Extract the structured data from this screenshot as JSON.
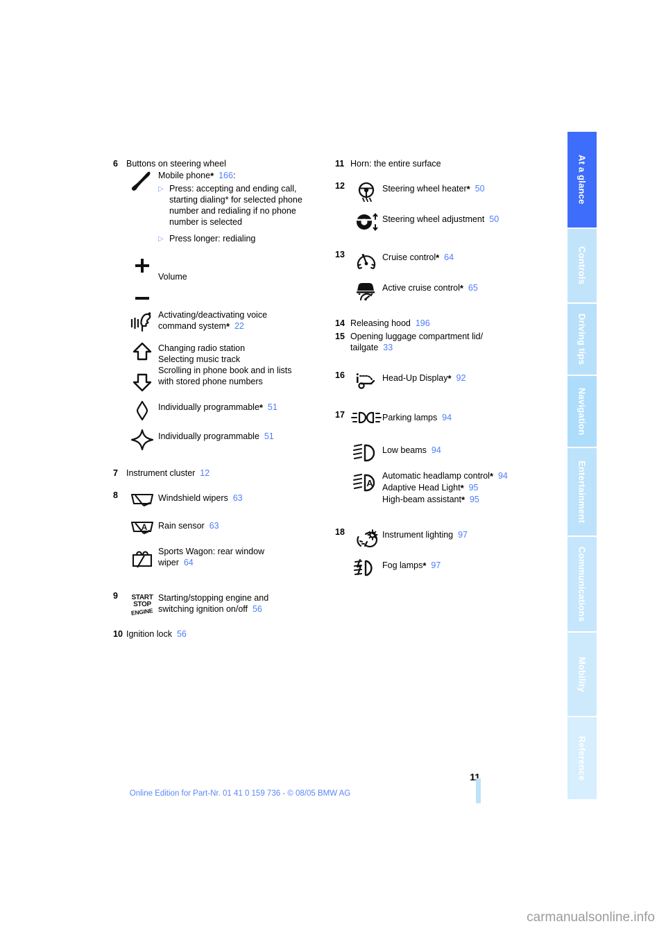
{
  "document": {
    "page_number": "11",
    "edition_line": "Online Edition for Part-Nr. 01 41 0 159 736 - © 08/05 BMW AG",
    "watermark": "carmanualsonline.info",
    "accent_page_ref_color": "#4d7dfb",
    "active_tab_color": "#3d6dfa"
  },
  "sidebar": {
    "tabs": [
      {
        "label": "At a glance",
        "active": true
      },
      {
        "label": "Controls",
        "active": false
      },
      {
        "label": "Driving tips",
        "active": false
      },
      {
        "label": "Navigation",
        "active": false
      },
      {
        "label": "Entertainment",
        "active": false
      },
      {
        "label": "Communications",
        "active": false
      },
      {
        "label": "Mobility",
        "active": false
      },
      {
        "label": "Reference",
        "active": false
      }
    ]
  },
  "left_column": {
    "item6": {
      "number": "6",
      "title": "Buttons on steering wheel",
      "phone": {
        "label": "Mobile phone",
        "star": "*",
        "page": "166",
        "colon": ":",
        "bullets": [
          "Press: accepting and ending call, starting dialing* for selected phone number and redialing if no phone number is selected",
          "Press longer: redialing"
        ],
        "bullet_marker": "▷"
      },
      "volume": {
        "label": "Volume"
      },
      "voice": {
        "label_line1": "Activating/deactivating voice",
        "label_line2": "command system",
        "star": "*",
        "page": "22"
      },
      "arrows": {
        "line1": "Changing radio station",
        "line2": "Selecting music track",
        "line3": "Scrolling in phone book and in lists",
        "line4": "with stored phone numbers"
      },
      "prog_star": {
        "label": "Individually programmable",
        "star": "*",
        "page": "51"
      },
      "prog_plain": {
        "label": "Individually programmable",
        "page": "51"
      }
    },
    "item7": {
      "number": "7",
      "label": "Instrument cluster",
      "page": "12"
    },
    "item8": {
      "number": "8",
      "wipers": {
        "label": "Windshield wipers",
        "page": "63"
      },
      "rain": {
        "label": "Rain sensor",
        "page": "63"
      },
      "wagon": {
        "line1": "Sports Wagon: rear window",
        "line2": "wiper",
        "page": "64"
      }
    },
    "item9": {
      "number": "9",
      "icon_text": {
        "l1": "START",
        "l2": "STOP",
        "l3": "ENGINE"
      },
      "line1": "Starting/stopping engine and",
      "line2": "switching ignition on/off",
      "page": "56"
    },
    "item10": {
      "number": "10",
      "label": "Ignition lock",
      "page": "56"
    }
  },
  "right_column": {
    "item11": {
      "number": "11",
      "label": "Horn: the entire surface"
    },
    "item12": {
      "number": "12",
      "heater": {
        "label": "Steering wheel heater",
        "star": "*",
        "page": "50"
      },
      "adjust": {
        "label": "Steering wheel adjustment",
        "page": "50"
      }
    },
    "item13": {
      "number": "13",
      "cruise": {
        "label": "Cruise control",
        "star": "*",
        "page": "64"
      },
      "active_cruise": {
        "label": "Active cruise control",
        "star": "*",
        "page": "65"
      }
    },
    "item14": {
      "number": "14",
      "label": "Releasing hood",
      "page": "196"
    },
    "item15": {
      "number": "15",
      "line1": "Opening luggage compartment lid/",
      "line2": "tailgate",
      "page": "33"
    },
    "item16": {
      "number": "16",
      "label": "Head-Up Display",
      "star": "*",
      "page": "92"
    },
    "item17": {
      "number": "17",
      "parking": {
        "label": "Parking lamps",
        "page": "94"
      },
      "low_beam": {
        "label": "Low beams",
        "page": "94"
      },
      "auto": {
        "line1_label": "Automatic headlamp control",
        "line1_star": "*",
        "line1_page": "94",
        "line2_label": "Adaptive Head Light",
        "line2_star": "*",
        "line2_page": "95",
        "line3_label": "High-beam assistant",
        "line3_star": "*",
        "line3_page": "95"
      }
    },
    "item18": {
      "number": "18",
      "instrument": {
        "label": "Instrument lighting",
        "page": "97"
      },
      "fog": {
        "label": "Fog lamps",
        "star": "*",
        "page": "97"
      }
    }
  }
}
